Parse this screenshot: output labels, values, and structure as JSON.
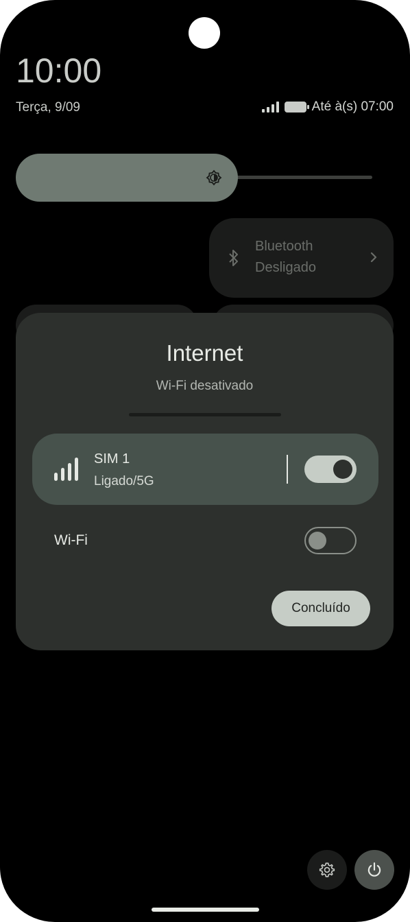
{
  "status": {
    "time": "10:00",
    "date": "Terça, 9/09",
    "alarm": "Até à(s) 07:00"
  },
  "quick_settings": {
    "brightness_level": 0.6,
    "bluetooth": {
      "title": "Bluetooth",
      "state": "Desligado"
    }
  },
  "dialog": {
    "title": "Internet",
    "subtitle": "Wi-Fi desativado",
    "sim": {
      "name": "SIM 1",
      "status": "Ligado/5G",
      "enabled": true
    },
    "wifi": {
      "label": "Wi-Fi",
      "enabled": false
    },
    "done_label": "Concluído"
  },
  "colors": {
    "background": "#000000",
    "dialog": "#2d302d",
    "accent": "#c6cdc6",
    "sim_card": "#47524c"
  },
  "icons": [
    "signal-icon",
    "battery-icon",
    "brightness-icon",
    "bluetooth-icon",
    "chevron-right-icon",
    "cellular-signal-icon",
    "gear-icon",
    "power-icon"
  ]
}
